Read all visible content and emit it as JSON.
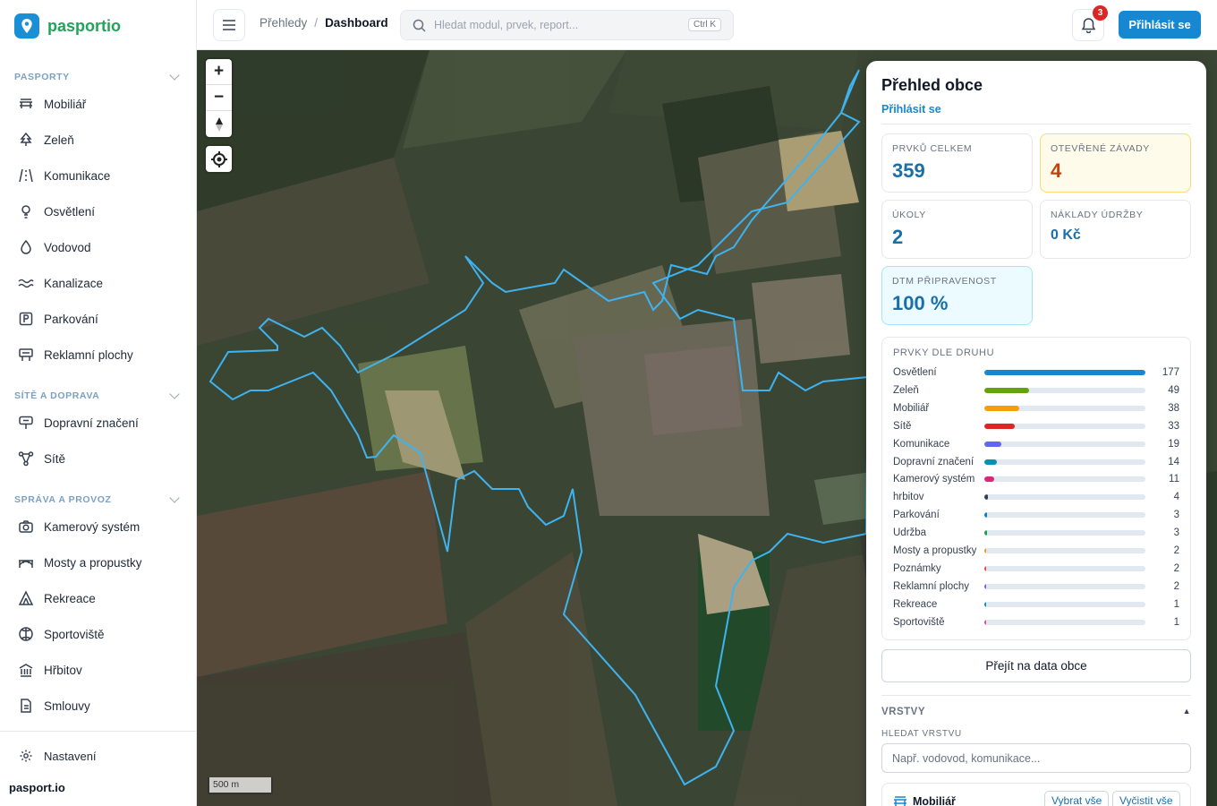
{
  "app": {
    "name": "pasportio",
    "footer_brand": "pasport.io"
  },
  "sidebar": {
    "sections": [
      {
        "label": "PASPORTY"
      },
      {
        "label": "SÍTĚ A DOPRAVA"
      },
      {
        "label": "SPRÁVA A PROVOZ"
      }
    ],
    "items": [
      {
        "label": "Mobiliář",
        "icon": "bench-icon"
      },
      {
        "label": "Zeleň",
        "icon": "tree-icon"
      },
      {
        "label": "Komunikace",
        "icon": "road-icon"
      },
      {
        "label": "Osvětlení",
        "icon": "lightbulb-icon"
      },
      {
        "label": "Vodovod",
        "icon": "droplet-icon"
      },
      {
        "label": "Kanalizace",
        "icon": "waves-icon"
      },
      {
        "label": "Parkování",
        "icon": "parking-icon"
      },
      {
        "label": "Reklamní plochy",
        "icon": "billboard-icon"
      },
      {
        "label": "Dopravní značení",
        "icon": "sign-icon"
      },
      {
        "label": "Sítě",
        "icon": "network-icon"
      },
      {
        "label": "Kamerový systém",
        "icon": "camera-icon"
      },
      {
        "label": "Mosty a propustky",
        "icon": "bridge-icon"
      },
      {
        "label": "Rekreace",
        "icon": "tent-icon"
      },
      {
        "label": "Sportoviště",
        "icon": "ball-icon"
      },
      {
        "label": "Hřbitov",
        "icon": "landmark-icon"
      },
      {
        "label": "Smlouvy",
        "icon": "document-icon"
      }
    ],
    "settings_label": "Nastavení"
  },
  "header": {
    "breadcrumb": [
      "Přehledy",
      "Dashboard"
    ],
    "search_placeholder": "Hledat modul, prvek, report...",
    "search_shortcut": "Ctrl K",
    "notifications_count": "3",
    "login_label": "Přihlásit se"
  },
  "map": {
    "scale_label": "500 m"
  },
  "panel": {
    "title": "Přehled obce",
    "login_link": "Přihlásit se",
    "stats": [
      {
        "label": "PRVKŮ CELKEM",
        "value": "359"
      },
      {
        "label": "OTEVŘENÉ ZÁVADY",
        "value": "4"
      },
      {
        "label": "ÚKOLY",
        "value": "2"
      },
      {
        "label": "NÁKLADY ÚDRŽBY",
        "value": "0 Kč"
      },
      {
        "label": "DTM PŘIPRAVENOST",
        "value": "100 %"
      }
    ],
    "types_title": "PRVKY DLE DRUHU",
    "types": [
      {
        "name": "Osvětlení",
        "count": 177,
        "color": "#1787d1"
      },
      {
        "name": "Zeleň",
        "count": 49,
        "color": "#65a30d"
      },
      {
        "name": "Mobiliář",
        "count": 38,
        "color": "#f59e0b"
      },
      {
        "name": "Sítě",
        "count": 33,
        "color": "#dc2626"
      },
      {
        "name": "Komunikace",
        "count": 19,
        "color": "#6366f1"
      },
      {
        "name": "Dopravní značení",
        "count": 14,
        "color": "#0891b2"
      },
      {
        "name": "Kamerový systém",
        "count": 11,
        "color": "#db2777"
      },
      {
        "name": "hrbitov",
        "count": 4,
        "color": "#334155"
      },
      {
        "name": "Parkování",
        "count": 3,
        "color": "#0284c7"
      },
      {
        "name": "Údržba",
        "count": 3,
        "color": "#16a34a"
      },
      {
        "name": "Mosty a propustky",
        "count": 2,
        "color": "#f59e0b"
      },
      {
        "name": "Poznámky",
        "count": 2,
        "color": "#ef4444"
      },
      {
        "name": "Reklamní plochy",
        "count": 2,
        "color": "#6366f1"
      },
      {
        "name": "Rekreace",
        "count": 1,
        "color": "#0891b2"
      },
      {
        "name": "Sportoviště",
        "count": 1,
        "color": "#ec4899"
      }
    ],
    "goto_label": "Přejít na data obce",
    "layers_label": "VRSTVY",
    "layers_toggle": "▲",
    "layer_search_label": "HLEDAT VRSTVU",
    "layer_search_placeholder": "Např. vodovod, komunikace...",
    "layer_card": {
      "name": "Mobiliář",
      "select_all": "Vybrat vše",
      "clear_all": "Vyčistit vše"
    }
  }
}
